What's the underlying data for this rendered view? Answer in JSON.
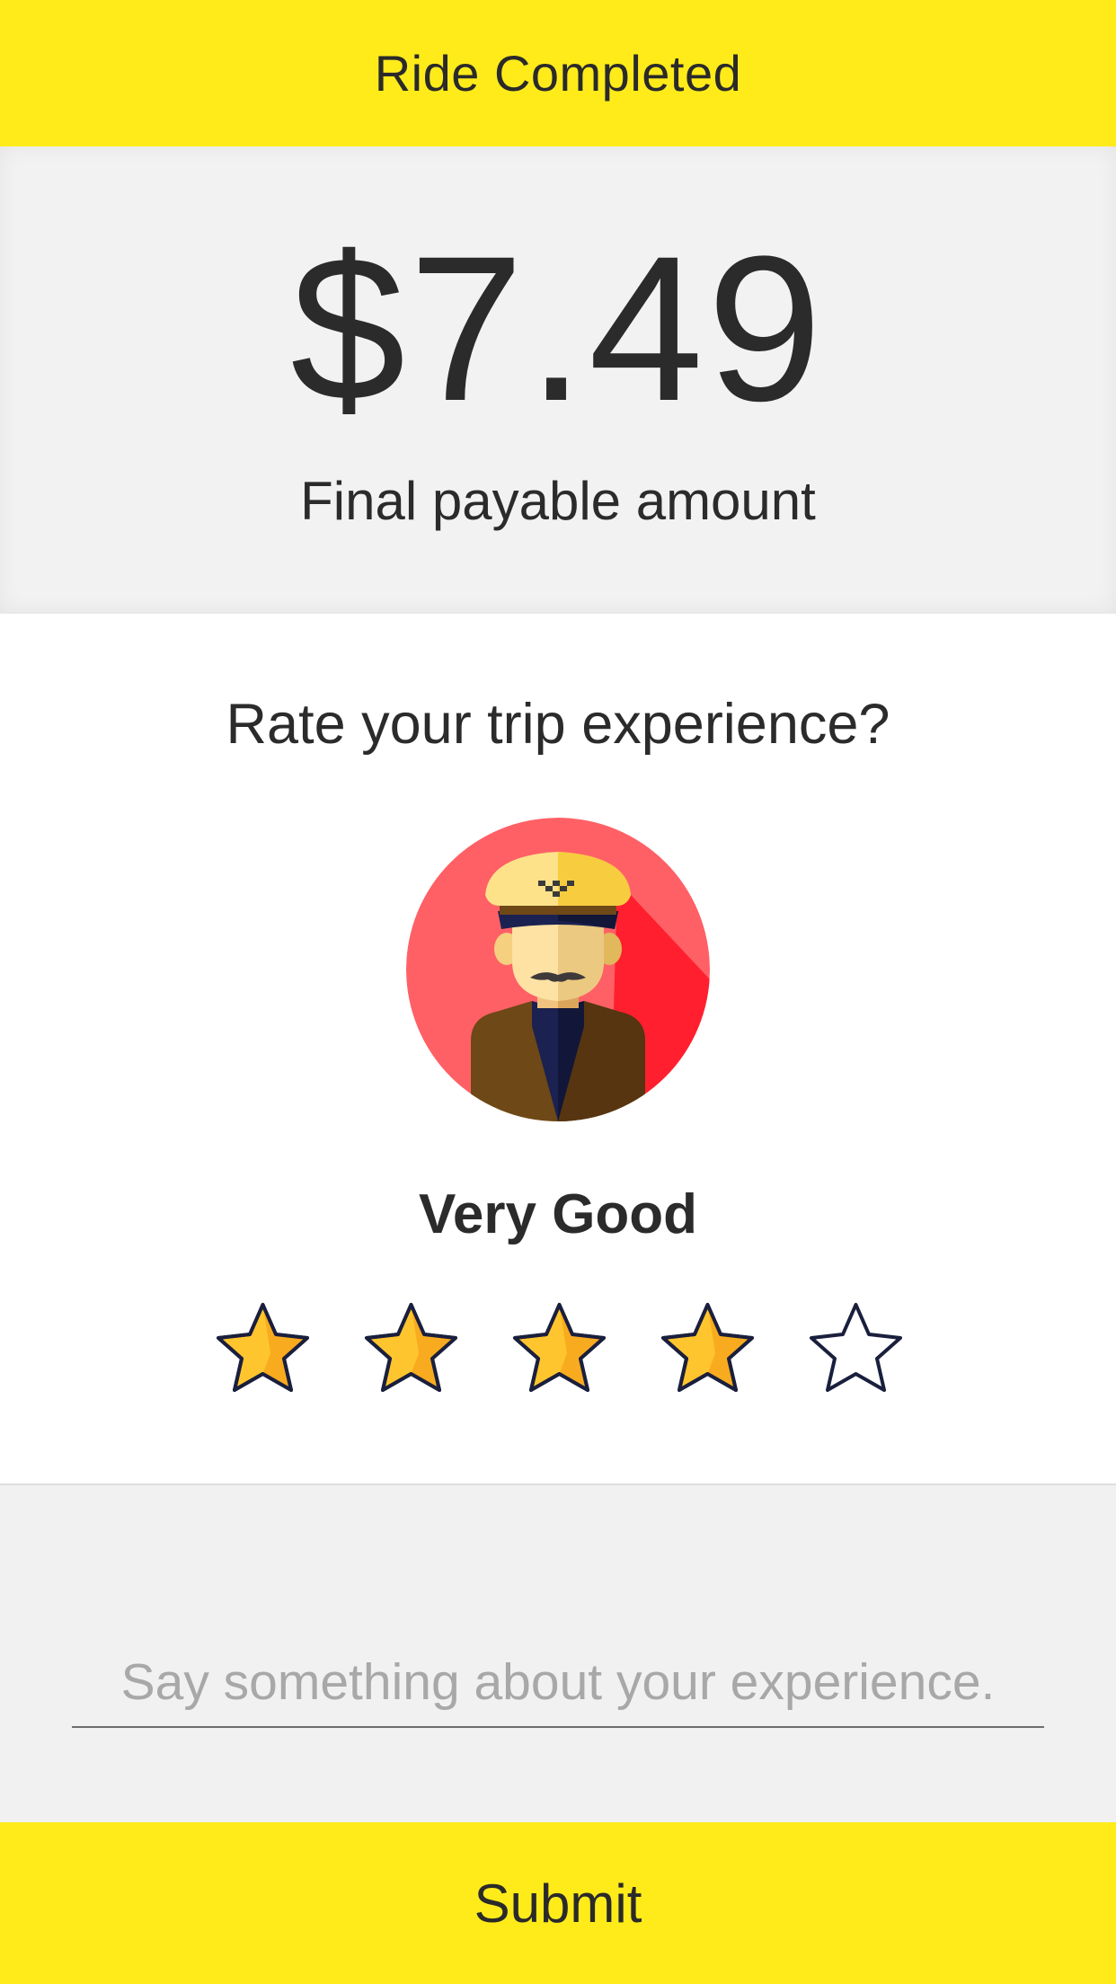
{
  "header": {
    "title": "Ride Completed"
  },
  "fare": {
    "amount": "$7.49",
    "label": "Final payable amount"
  },
  "rating": {
    "question": "Rate your trip experience?",
    "driver_avatar_icon": "taxi-driver-avatar",
    "selected_label": "Very Good",
    "value": 4,
    "max": 5,
    "star_filled_icon": "star-filled-icon",
    "star_empty_icon": "star-outline-icon"
  },
  "comment": {
    "placeholder": "Say something about your experience.",
    "value": ""
  },
  "actions": {
    "submit_label": "Submit"
  },
  "colors": {
    "accent_yellow": "#ffeb1a",
    "panel_gray": "#f2f2f2",
    "avatar_red": "#ff6066",
    "star_gold": "#ffc52e"
  }
}
